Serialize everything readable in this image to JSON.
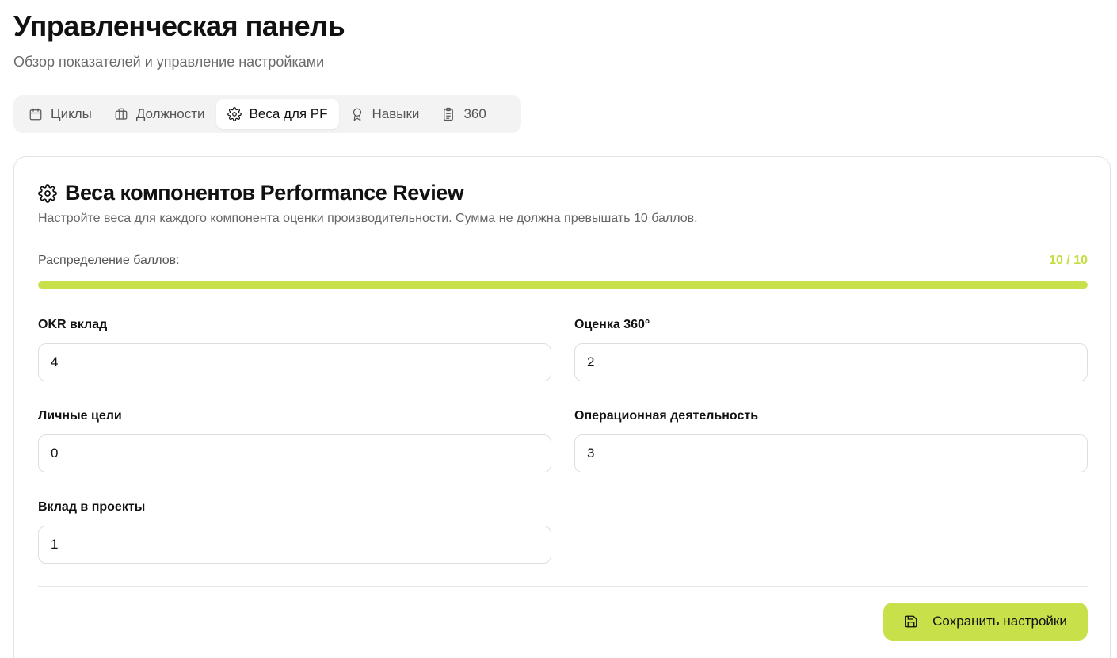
{
  "header": {
    "title": "Управленческая панель",
    "subtitle": "Обзор показателей и управление настройками"
  },
  "tabs": [
    {
      "label": "Циклы",
      "icon": "calendar-icon",
      "active": false
    },
    {
      "label": "Должности",
      "icon": "briefcase-icon",
      "active": false
    },
    {
      "label": "Веса для PF",
      "icon": "gear-icon",
      "active": true
    },
    {
      "label": "Навыки",
      "icon": "award-icon",
      "active": false
    },
    {
      "label": "360",
      "icon": "clipboard-icon",
      "active": false
    }
  ],
  "card": {
    "icon": "gear-icon",
    "title": "Веса компонентов Performance Review",
    "description": "Настройте веса для каждого компонента оценки производительности. Сумма не должна превышать 10 баллов.",
    "distribution": {
      "label": "Распределение баллов:",
      "value_text": "10 / 10",
      "current": 10,
      "max": 10
    },
    "fields": {
      "okr": {
        "label": "OKR вклад",
        "value": "4"
      },
      "review360": {
        "label": "Оценка 360°",
        "value": "2"
      },
      "personal": {
        "label": "Личные цели",
        "value": "0"
      },
      "operational": {
        "label": "Операционная деятельность",
        "value": "3"
      },
      "projects": {
        "label": "Вклад в проекты",
        "value": "1"
      }
    },
    "save_label": "Сохранить настройки"
  },
  "colors": {
    "accent": "#c8e04a",
    "accent_text": "#c5dd3f"
  }
}
